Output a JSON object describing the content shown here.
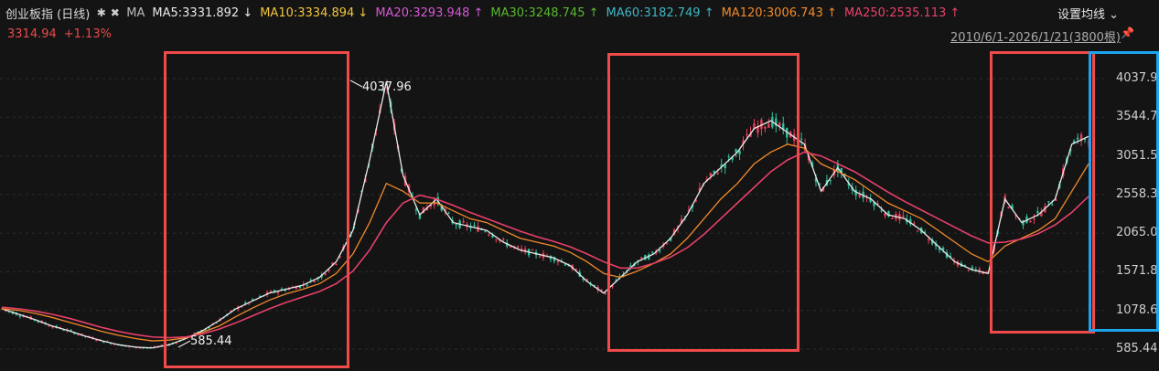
{
  "header": {
    "title": "创业板指 (日线)",
    "ma_label": "MA",
    "ma_items": [
      {
        "text": "MA5:3331.892",
        "arrow": "↓",
        "color": "#e8e8e8"
      },
      {
        "text": "MA10:3334.894",
        "arrow": "↓",
        "color": "#f2c53d"
      },
      {
        "text": "MA20:3293.948",
        "arrow": "↑",
        "color": "#d658d6"
      },
      {
        "text": "MA30:3248.745",
        "arrow": "↑",
        "color": "#58b82e"
      },
      {
        "text": "MA60:3182.749",
        "arrow": "↑",
        "color": "#3fb6c4"
      },
      {
        "text": "MA120:3006.743",
        "arrow": "↑",
        "color": "#f28a2a"
      },
      {
        "text": "MA250:2535.113",
        "arrow": "↑",
        "color": "#e8406a"
      }
    ],
    "price": "3314.94",
    "change": "+1.13%",
    "settings_label": "设置均线",
    "settings_arrow": "⌄",
    "date_range": "2010/6/1-2026/1/21(3800根)"
  },
  "chart_data": {
    "type": "candlestick-line",
    "x_range": [
      "2010/6/1",
      "2026/1/21"
    ],
    "bar_count": 3800,
    "y_ticks": [
      "4037.9",
      "3544.7",
      "3051.5",
      "2558.3",
      "2065.0",
      "1571.8",
      "1078.6",
      "585.44"
    ],
    "ylim": [
      585.44,
      4037.9
    ],
    "grid": true,
    "annotations": {
      "high_label": "4037.96",
      "low_label": "585.44"
    },
    "series": [
      {
        "name": "MA5",
        "color": "#e8e8e8",
        "values": [
          1100,
          1030,
          960,
          880,
          820,
          750,
          690,
          640,
          610,
          600,
          640,
          720,
          820,
          950,
          1100,
          1200,
          1300,
          1350,
          1400,
          1500,
          1700,
          2100,
          3000,
          4000,
          2800,
          2300,
          2500,
          2200,
          2150,
          2100,
          1950,
          1850,
          1800,
          1750,
          1650,
          1450,
          1300,
          1500,
          1700,
          1800,
          2000,
          2300,
          2700,
          2900,
          3100,
          3400,
          3500,
          3350,
          3200,
          2600,
          2900,
          2600,
          2500,
          2300,
          2250,
          2100,
          1900,
          1700,
          1600,
          1550,
          2500,
          2200,
          2300,
          2500,
          3200,
          3300
        ]
      },
      {
        "name": "MA120",
        "color": "#f28a2a",
        "values": [
          1100,
          1080,
          1040,
          990,
          930,
          870,
          810,
          760,
          720,
          690,
          700,
          730,
          800,
          880,
          1000,
          1110,
          1210,
          1290,
          1350,
          1420,
          1550,
          1800,
          2200,
          2700,
          2600,
          2450,
          2450,
          2350,
          2250,
          2200,
          2100,
          2000,
          1950,
          1900,
          1820,
          1700,
          1550,
          1500,
          1580,
          1680,
          1800,
          2000,
          2250,
          2500,
          2700,
          2950,
          3100,
          3200,
          3150,
          2950,
          2850,
          2750,
          2600,
          2450,
          2350,
          2250,
          2100,
          1950,
          1800,
          1700,
          1900,
          2000,
          2100,
          2250,
          2600,
          2950
        ]
      },
      {
        "name": "MA250",
        "color": "#e8406a",
        "values": [
          1120,
          1100,
          1070,
          1030,
          980,
          920,
          860,
          810,
          770,
          740,
          730,
          740,
          780,
          840,
          920,
          1010,
          1100,
          1180,
          1250,
          1320,
          1420,
          1580,
          1850,
          2200,
          2450,
          2550,
          2500,
          2420,
          2330,
          2250,
          2170,
          2090,
          2020,
          1960,
          1890,
          1800,
          1700,
          1620,
          1620,
          1680,
          1760,
          1880,
          2050,
          2250,
          2450,
          2650,
          2850,
          3000,
          3100,
          3050,
          2950,
          2850,
          2720,
          2590,
          2470,
          2360,
          2250,
          2140,
          2030,
          1940,
          1950,
          1990,
          2060,
          2170,
          2330,
          2535
        ]
      }
    ]
  },
  "highlights": {
    "boxes": 3,
    "price_axis_box": true,
    "box_color": "#f04a4a",
    "axis_box_color": "#1ea4ee"
  }
}
